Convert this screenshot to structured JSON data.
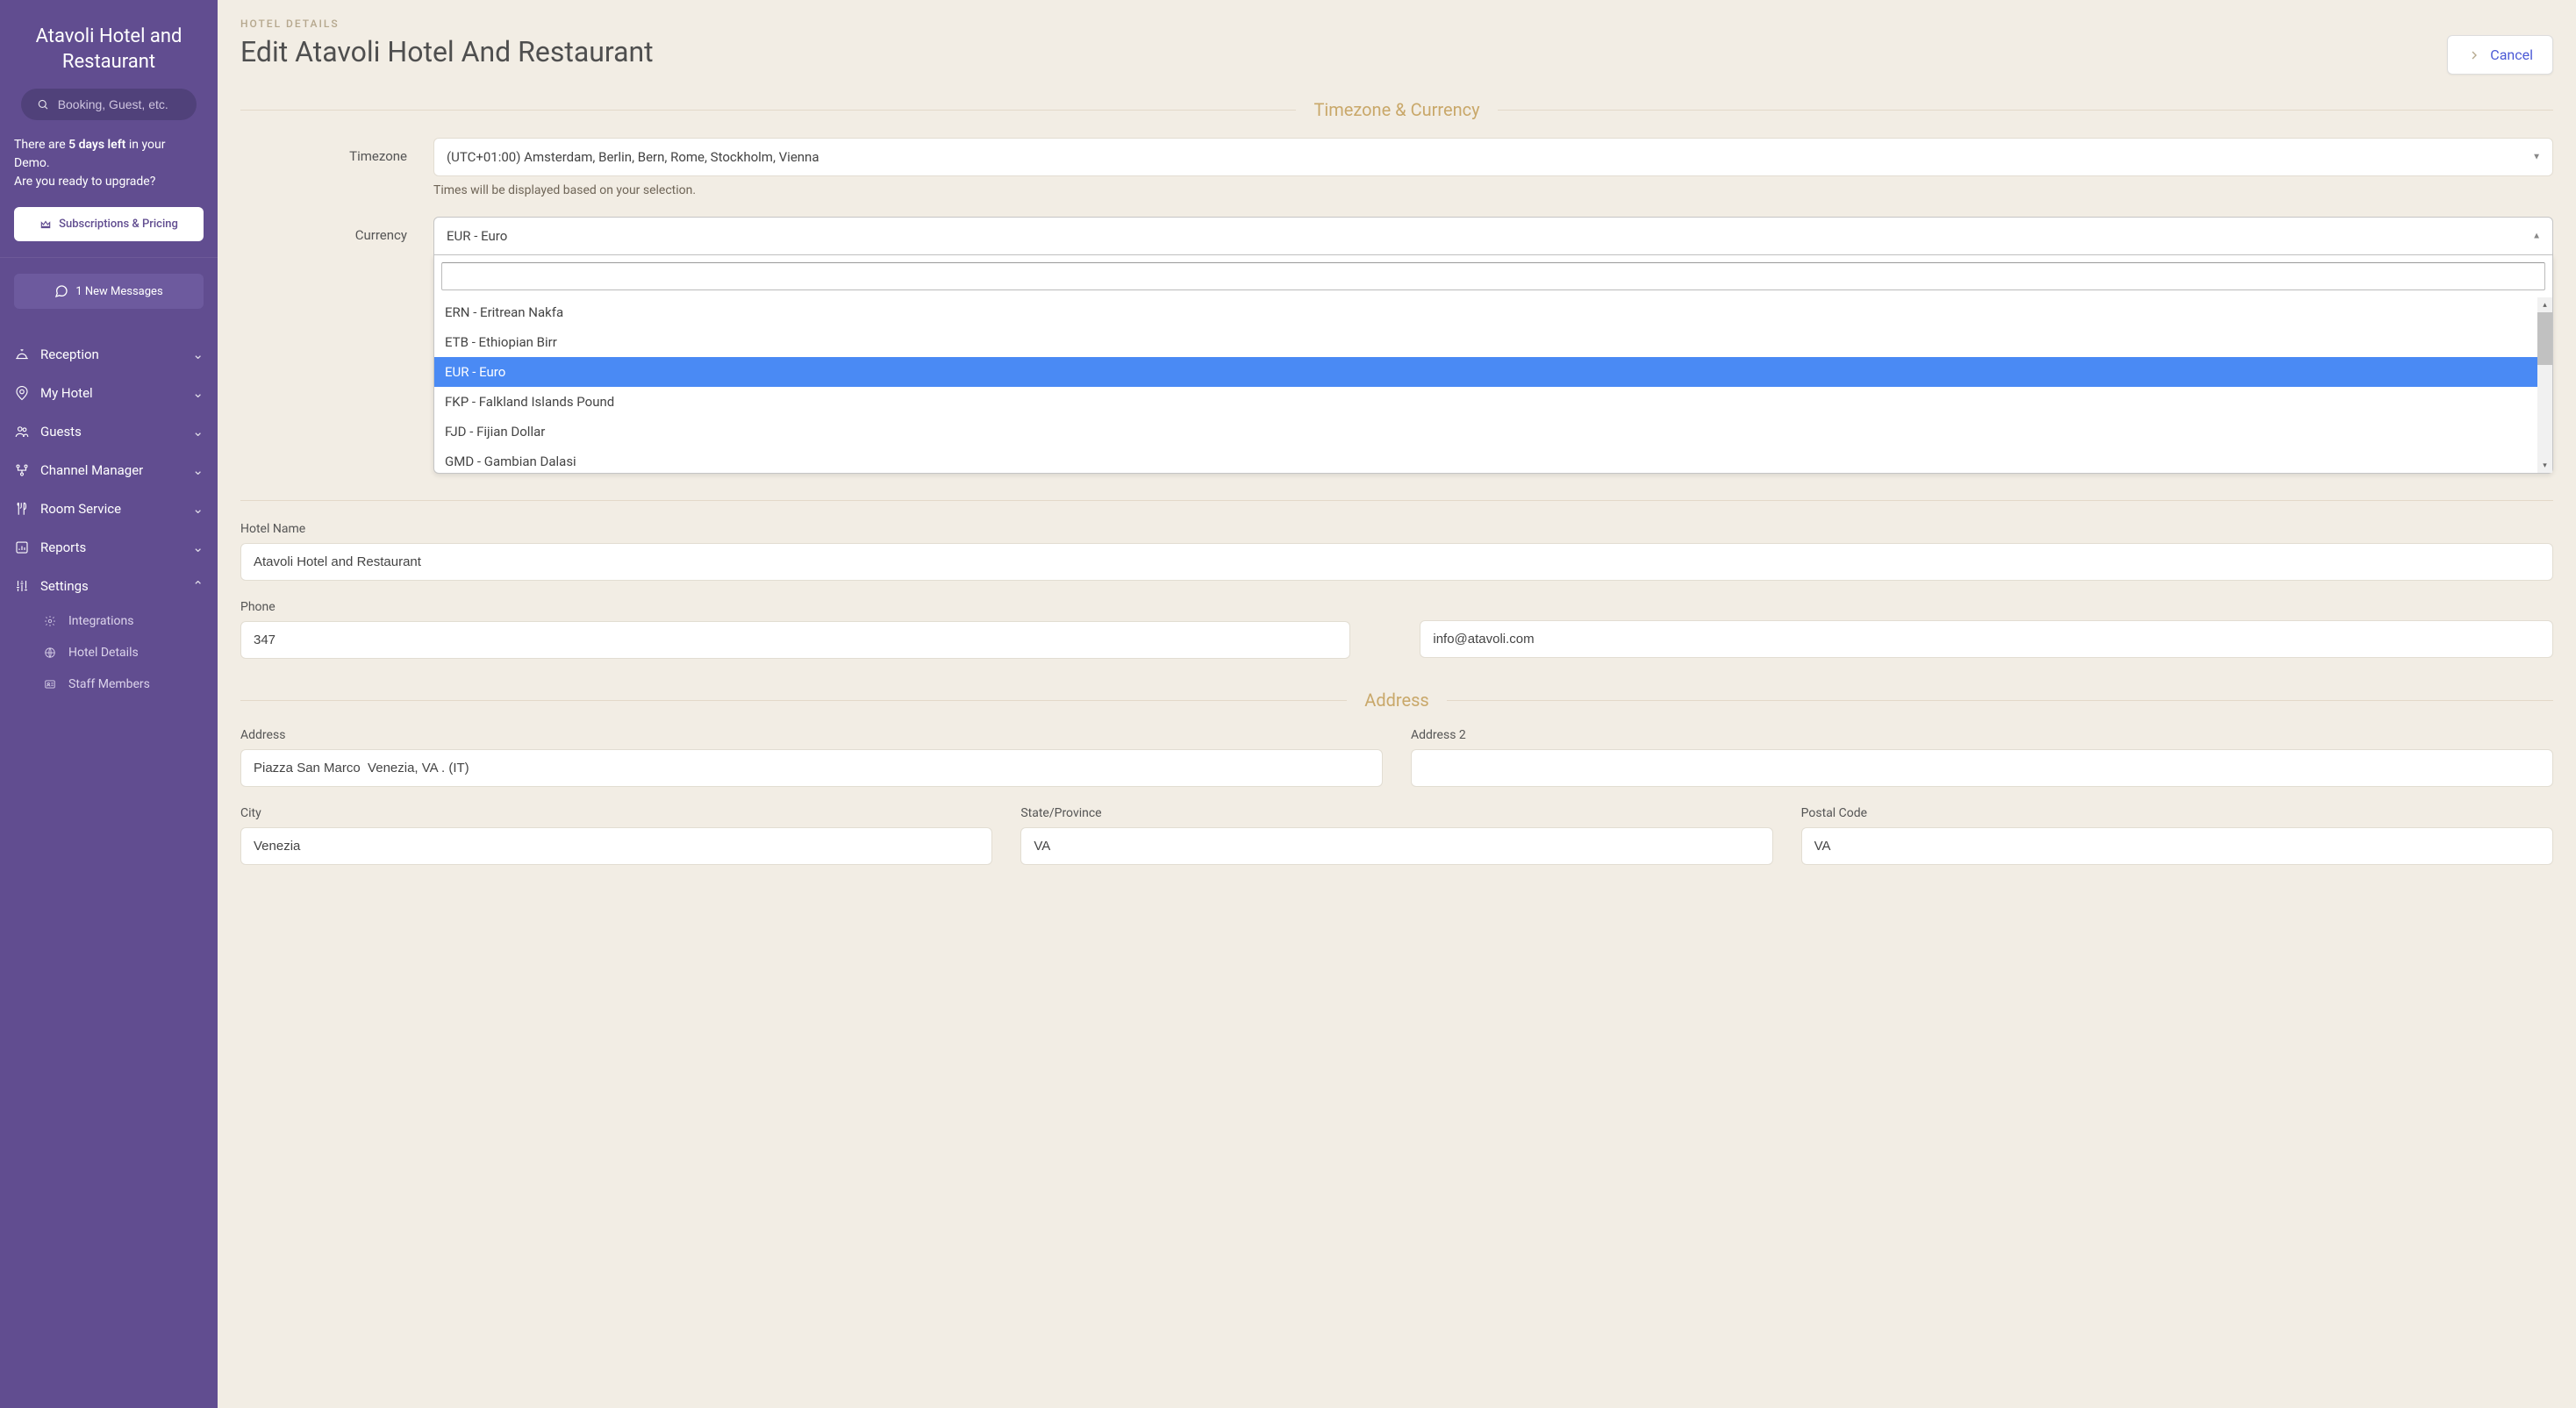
{
  "sidebar": {
    "title": "Atavoli Hotel and Restaurant",
    "search_placeholder": "Booking, Guest, etc.",
    "demo_prefix": "There are ",
    "demo_bold": "5 days left",
    "demo_mid": " in your Demo.",
    "demo_line2": "Are you ready to upgrade?",
    "subscriptions_label": "Subscriptions & Pricing",
    "messages_label": "1 New Messages",
    "nav": [
      {
        "label": "Reception"
      },
      {
        "label": "My Hotel"
      },
      {
        "label": "Guests"
      },
      {
        "label": "Channel Manager"
      },
      {
        "label": "Room Service"
      },
      {
        "label": "Reports"
      },
      {
        "label": "Settings"
      }
    ],
    "settings_sub": [
      {
        "label": "Integrations"
      },
      {
        "label": "Hotel Details"
      },
      {
        "label": "Staff Members"
      }
    ]
  },
  "header": {
    "breadcrumb": "HOTEL DETAILS",
    "title": "Edit Atavoli Hotel And Restaurant",
    "cancel_label": "Cancel"
  },
  "sections": {
    "tz_currency": "Timezone & Currency",
    "address": "Address"
  },
  "form": {
    "timezone_label": "Timezone",
    "timezone_value": "(UTC+01:00) Amsterdam, Berlin, Bern, Rome, Stockholm, Vienna",
    "timezone_helper": "Times will be displayed based on your selection.",
    "currency_label": "Currency",
    "currency_value": "EUR - Euro",
    "hotel_name_label": "Hotel Name",
    "hotel_name_value": "Atavoli Hotel and Restaurant",
    "phone_label": "Phone",
    "phone_value": "347",
    "email_value": "info@atavoli.com",
    "address_label": "Address",
    "address_value": "Piazza San Marco  Venezia, VA . (IT)",
    "address2_label": "Address 2",
    "address2_value": "",
    "city_label": "City",
    "city_value": "Venezia",
    "state_label": "State/Province",
    "state_value": "VA",
    "postal_label": "Postal Code",
    "postal_value": "VA"
  },
  "currency_dropdown": {
    "search_value": "",
    "options": [
      {
        "label": "ERN - Eritrean Nakfa",
        "selected": false
      },
      {
        "label": "ETB - Ethiopian Birr",
        "selected": false
      },
      {
        "label": "EUR - Euro",
        "selected": true
      },
      {
        "label": "FKP - Falkland Islands Pound",
        "selected": false
      },
      {
        "label": "FJD - Fijian Dollar",
        "selected": false
      },
      {
        "label": "GMD - Gambian Dalasi",
        "selected": false
      }
    ]
  }
}
